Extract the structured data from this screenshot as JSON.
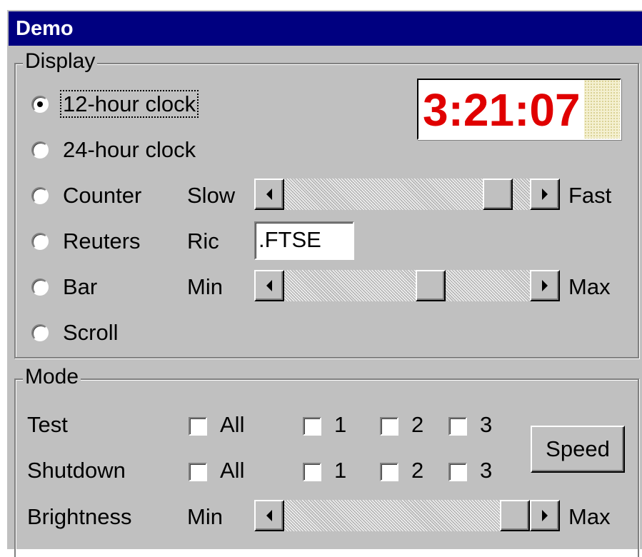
{
  "window": {
    "title": "Demo"
  },
  "display": {
    "legend": "Display",
    "options": [
      {
        "label": "12-hour clock",
        "selected": true
      },
      {
        "label": "24-hour clock",
        "selected": false
      },
      {
        "label": "Counter",
        "selected": false
      },
      {
        "label": "Reuters",
        "selected": false
      },
      {
        "label": "Bar",
        "selected": false
      },
      {
        "label": "Scroll",
        "selected": false
      }
    ],
    "clock": {
      "time": "3:21:07",
      "color": "#e00000"
    },
    "speed": {
      "min_label": "Slow",
      "max_label": "Fast",
      "value": 0.92
    },
    "ric": {
      "label": "Ric",
      "value": ".FTSE"
    },
    "bar": {
      "min_label": "Min",
      "max_label": "Max",
      "value": 0.61
    }
  },
  "mode": {
    "legend": "Mode",
    "rows": [
      {
        "label": "Test",
        "checks": [
          {
            "label": "All",
            "checked": false
          },
          {
            "label": "1",
            "checked": false
          },
          {
            "label": "2",
            "checked": false
          },
          {
            "label": "3",
            "checked": false
          }
        ]
      },
      {
        "label": "Shutdown",
        "checks": [
          {
            "label": "All",
            "checked": false
          },
          {
            "label": "1",
            "checked": false
          },
          {
            "label": "2",
            "checked": false
          },
          {
            "label": "3",
            "checked": false
          }
        ]
      }
    ],
    "speed_button": "Speed",
    "brightness": {
      "label": "Brightness",
      "min_label": "Min",
      "max_label": "Max",
      "value": 1.0
    }
  },
  "colors": {
    "titlebar": "#000080",
    "face": "#c0c0c0",
    "clock_text": "#e00000"
  }
}
